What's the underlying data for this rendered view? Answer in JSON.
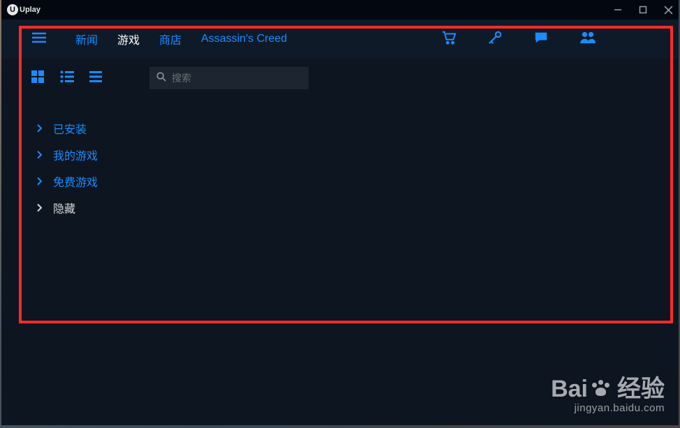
{
  "logo": {
    "text": "Uplay"
  },
  "nav": {
    "items": [
      {
        "label": "新闻",
        "active": false
      },
      {
        "label": "游戏",
        "active": true
      },
      {
        "label": "商店",
        "active": false
      },
      {
        "label": "Assassin's Creed",
        "active": false
      }
    ]
  },
  "search": {
    "placeholder": "搜索"
  },
  "categories": [
    {
      "label": "已安装",
      "expanded": false
    },
    {
      "label": "我的游戏",
      "expanded": false
    },
    {
      "label": "免费游戏",
      "expanded": false
    },
    {
      "label": "隐藏",
      "expanded": true
    }
  ],
  "watermark": {
    "brand": "Bai",
    "brand2": "经验",
    "url": "jingyan.baidu.com"
  }
}
